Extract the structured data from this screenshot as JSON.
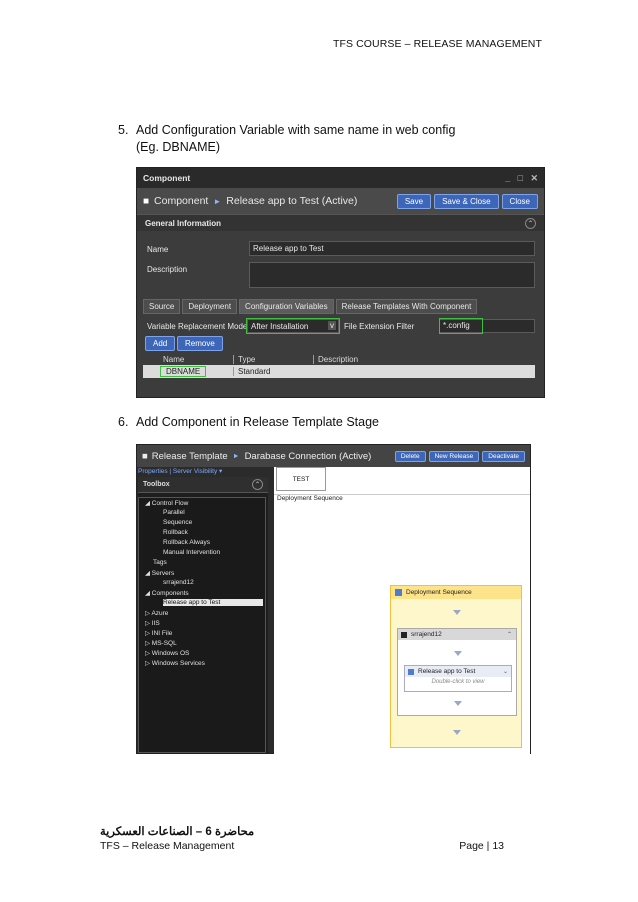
{
  "header": {
    "text": "TFS COURSE – RELEASE MANAGEMENT"
  },
  "steps": [
    {
      "number": "5.",
      "line1": "Add Configuration Variable with same name in web config",
      "line2": "(Eg. DBNAME)"
    },
    {
      "number": "6.",
      "line1": "Add Component in Release Template Stage"
    }
  ],
  "shot1": {
    "window_title": "Component",
    "window_controls": [
      "_",
      "□",
      "✕"
    ],
    "breadcrumb_root": "Component",
    "breadcrumb_current": "Release app to Test (Active)",
    "buttons": [
      "Save",
      "Save & Close",
      "Close"
    ],
    "section": "General Information",
    "name_label": "Name",
    "name_value": "Release app to Test",
    "description_label": "Description",
    "description_value": "",
    "tabs": [
      "Source",
      "Deployment",
      "Configuration Variables",
      "Release Templates With Component"
    ],
    "var_mode_label": "Variable Replacement Mode",
    "var_mode_value": "After Installation",
    "file_filter_label": "File Extension Filter",
    "file_filter_value": "*.config",
    "add_label": "Add",
    "remove_label": "Remove",
    "columns": [
      "Name",
      "Type",
      "Description"
    ],
    "rows": [
      {
        "name": "DBNAME",
        "type": "Standard",
        "description": ""
      }
    ]
  },
  "shot2": {
    "breadcrumb_root": "Release Template",
    "breadcrumb_current": "Darabase Connection (Active)",
    "buttons": [
      "Delete",
      "New Release",
      "Deactivate"
    ],
    "links": "Properties | Server Visibility ▾",
    "toolbox_title": "Toolbox",
    "tree": [
      {
        "label": "◢ Control Flow",
        "level": 0
      },
      {
        "label": "Parallel",
        "level": 2
      },
      {
        "label": "Sequence",
        "level": 2
      },
      {
        "label": "Rollback",
        "level": 2
      },
      {
        "label": "Rollback Always",
        "level": 2
      },
      {
        "label": "Manual Intervention",
        "level": 2
      },
      {
        "label": "Tags",
        "level": 1
      },
      {
        "label": "◢ Servers",
        "level": 0
      },
      {
        "label": "srrajend12",
        "level": 2
      },
      {
        "label": "◢ Components",
        "level": 0
      },
      {
        "label": "Release app to Test",
        "level": 2,
        "selected": true
      },
      {
        "label": "▷ Azure",
        "level": 0
      },
      {
        "label": "▷ IIS",
        "level": 0
      },
      {
        "label": "▷ INI File",
        "level": 0
      },
      {
        "label": "▷ MS-SQL",
        "level": 0
      },
      {
        "label": "▷ Windows OS",
        "level": 0
      },
      {
        "label": "▷ Windows Services",
        "level": 0
      }
    ],
    "stage_tab": "TEST",
    "deployment_label": "Deployment Sequence",
    "sequence_title": "Deployment Sequence",
    "server_name": "srrajend12",
    "component_name": "Release app to Test",
    "component_hint": "Double-click to view"
  },
  "footer": {
    "arabic": "محاضرة 6 – الصناعات العسكرية",
    "left": "TFS – Release Management",
    "right": "Page | 13"
  }
}
